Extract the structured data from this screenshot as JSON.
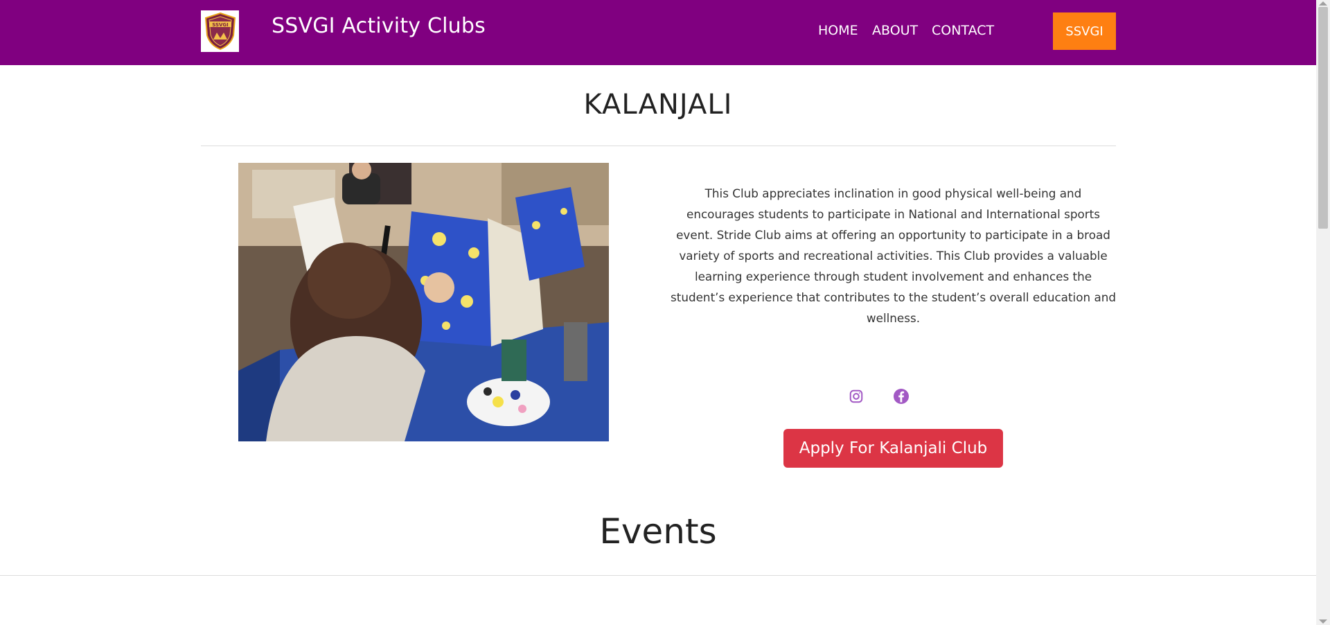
{
  "nav": {
    "brand": "SSVGI Activity Clubs",
    "logo_text": "SSVGI",
    "links": [
      {
        "label": "HOME"
      },
      {
        "label": "ABOUT"
      },
      {
        "label": "CONTACT"
      }
    ],
    "cta_label": "SSVGI"
  },
  "club": {
    "title": "KALANJALI",
    "description": "This Club appreciates inclination in good physical well-being and encourages students to participate in National and International sports event. Stride Club aims at offering an opportunity to participate in a broad variety of sports and recreational activities. This Club provides a valuable learning experience through student involvement and enhances the student’s experience that contributes to the student’s overall education and wellness.",
    "social_icons": [
      "instagram-icon",
      "facebook-icon"
    ],
    "apply_label": "Apply For Kalanjali Club"
  },
  "events": {
    "title": "Events"
  },
  "colors": {
    "navbar": "#800080",
    "cta": "#fe7f12",
    "apply": "#dc3545",
    "social": "#a259c4"
  }
}
